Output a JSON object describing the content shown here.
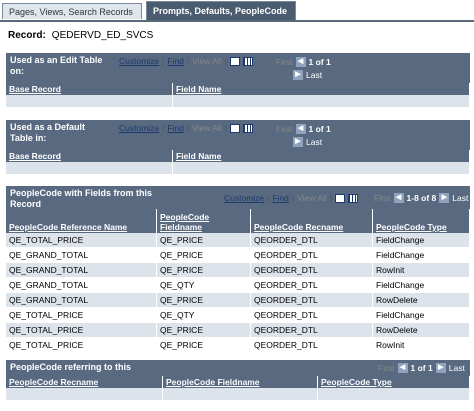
{
  "tabs": [
    {
      "label": "Pages, Views, Search Records",
      "active": false
    },
    {
      "label": "Prompts, Defaults, PeopleCode",
      "active": true
    }
  ],
  "record": {
    "label": "Record:",
    "value": "QEDERVD_ED_SVCS"
  },
  "nav": {
    "customize": "Customize",
    "find": "Find",
    "view_all": "View All",
    "first": "First",
    "last": "Last",
    "sep": "|"
  },
  "grid_edit": {
    "title": "Used as an Edit Table on:",
    "count": "1 of 1",
    "columns": [
      "Base Record",
      "Field Name"
    ],
    "rows": [
      [
        "",
        ""
      ]
    ]
  },
  "grid_default": {
    "title": "Used as a Default Table in:",
    "count": "1 of 1",
    "columns": [
      "Base Record",
      "Field Name"
    ],
    "rows": [
      [
        "",
        ""
      ]
    ]
  },
  "grid_peoplecode": {
    "title": "PeopleCode with Fields from this Record",
    "count": "1-8 of 8",
    "columns": [
      "PeopleCode Reference Name",
      "PeopleCode Fieldname",
      "PeopleCode Recname",
      "PeopleCode Type"
    ],
    "rows": [
      [
        "QE_TOTAL_PRICE",
        "QE_PRICE",
        "QEORDER_DTL",
        "FieldChange"
      ],
      [
        "QE_GRAND_TOTAL",
        "QE_PRICE",
        "QEORDER_DTL",
        "FieldChange"
      ],
      [
        "QE_GRAND_TOTAL",
        "QE_PRICE",
        "QEORDER_DTL",
        "RowInit"
      ],
      [
        "QE_GRAND_TOTAL",
        "QE_QTY",
        "QEORDER_DTL",
        "FieldChange"
      ],
      [
        "QE_GRAND_TOTAL",
        "QE_PRICE",
        "QEORDER_DTL",
        "RowDelete"
      ],
      [
        "QE_TOTAL_PRICE",
        "QE_QTY",
        "QEORDER_DTL",
        "FieldChange"
      ],
      [
        "QE_TOTAL_PRICE",
        "QE_PRICE",
        "QEORDER_DTL",
        "RowDelete"
      ],
      [
        "QE_TOTAL_PRICE",
        "QE_PRICE",
        "QEORDER_DTL",
        "RowInit"
      ]
    ]
  },
  "grid_referring": {
    "title": "PeopleCode referring to this",
    "count": "1 of 1",
    "columns": [
      "PeopleCode Recname",
      "PeopleCode Fieldname",
      "PeopleCode Type"
    ],
    "rows": [
      [
        "",
        "",
        ""
      ]
    ]
  },
  "colors": {
    "header": "#586980",
    "alt_row": "#dde3ea",
    "link": "#1d3a6e"
  }
}
